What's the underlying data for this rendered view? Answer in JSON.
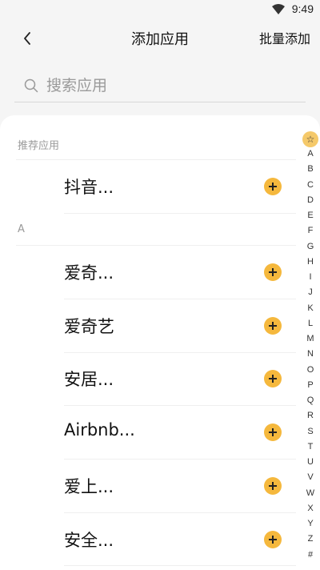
{
  "status_bar": {
    "time": "9:49"
  },
  "header": {
    "title": "添加应用",
    "bulk_add": "批量添加"
  },
  "search": {
    "placeholder": "搜索应用"
  },
  "sections": [
    {
      "header": "推荐应用",
      "apps": [
        {
          "name": "抖音..."
        }
      ]
    },
    {
      "header": "A",
      "apps": [
        {
          "name": "爱奇..."
        },
        {
          "name": "爱奇艺"
        },
        {
          "name": "安居..."
        },
        {
          "name": "Airbnb..."
        },
        {
          "name": "爱上..."
        },
        {
          "name": "安全..."
        }
      ]
    }
  ],
  "index_bar": {
    "star": "☆",
    "letters": [
      "A",
      "B",
      "C",
      "D",
      "E",
      "F",
      "G",
      "H",
      "I",
      "J",
      "K",
      "L",
      "M",
      "N",
      "O",
      "P",
      "Q",
      "R",
      "S",
      "T",
      "U",
      "V",
      "W",
      "X",
      "Y",
      "Z",
      "#"
    ]
  },
  "colors": {
    "accent": "#f5b83d",
    "background": "#f5f5f5",
    "card": "#ffffff"
  }
}
